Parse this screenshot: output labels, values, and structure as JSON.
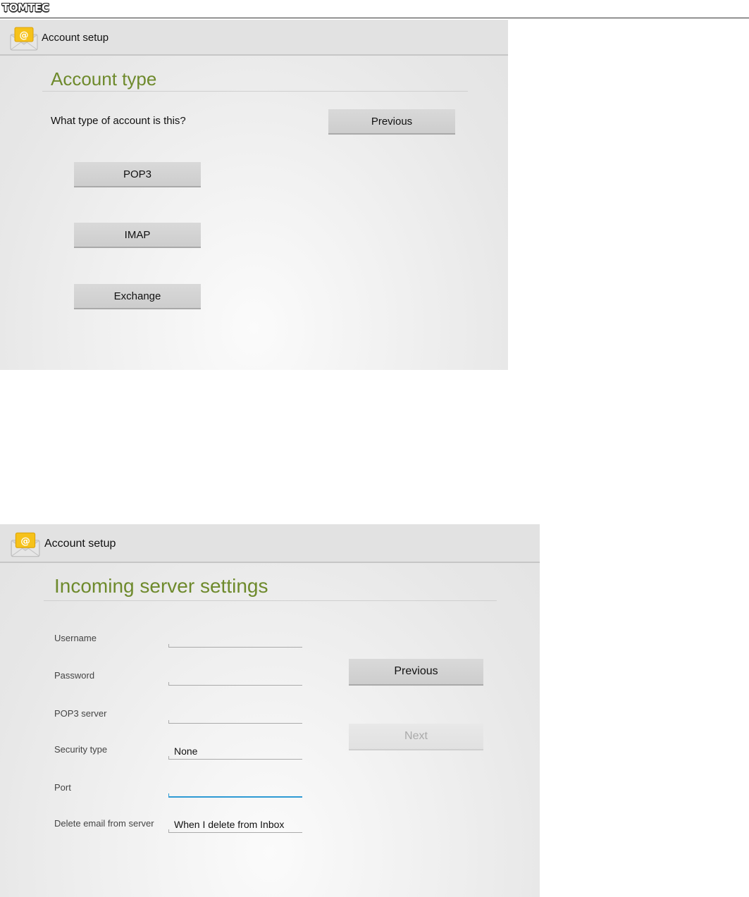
{
  "document": {
    "logo_text": "TOMTEC"
  },
  "screen1": {
    "titlebar": {
      "title": "Account setup"
    },
    "heading": "Account type",
    "question": "What type of account is this?",
    "previous_label": "Previous",
    "account_types": [
      "POP3",
      "IMAP",
      "Exchange"
    ]
  },
  "screen2": {
    "titlebar": {
      "title": "Account setup"
    },
    "heading": "Incoming server settings",
    "fields": [
      {
        "label": "Username",
        "value": ""
      },
      {
        "label": "Password",
        "value": ""
      },
      {
        "label": "POP3 server",
        "value": ""
      },
      {
        "label": "Security type",
        "value": "None"
      },
      {
        "label": "Port",
        "value": ""
      },
      {
        "label": "Delete email from server",
        "value": "When I delete from Inbox"
      }
    ],
    "previous_label": "Previous",
    "next_label": "Next"
  },
  "colors": {
    "heading_green": "#6e8a2c",
    "focus_blue": "#2e9ad4",
    "icon_yellow": "#f6c21a"
  }
}
